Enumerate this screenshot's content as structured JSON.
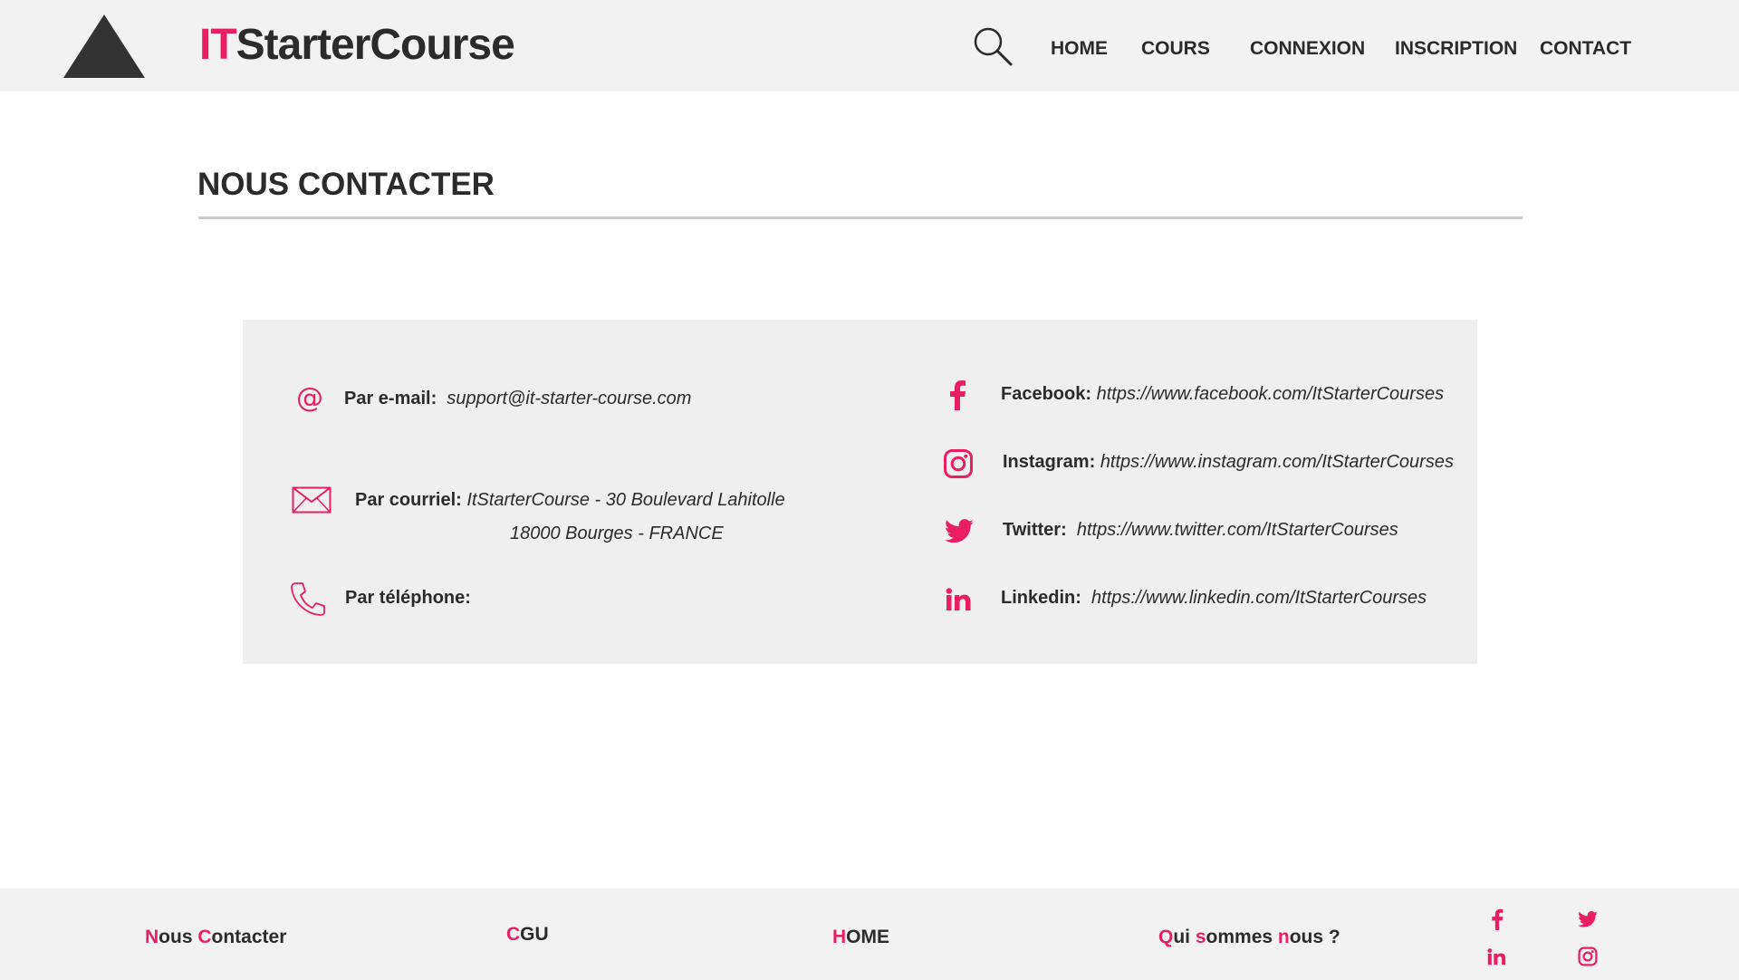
{
  "header": {
    "brand_prefix": "IT",
    "brand_suffix": "StarterCourse",
    "nav": {
      "home": "HOME",
      "cours": "COURS",
      "connexion": "CONNEXION",
      "inscription": "INSCRIPTION",
      "contact": "CONTACT"
    }
  },
  "page": {
    "title": "NOUS CONTACTER"
  },
  "contact": {
    "email": {
      "label": "Par e-mail:",
      "value": "support@it-starter-course.com",
      "icon": "at-icon"
    },
    "mail": {
      "label": "Par courriel:",
      "line1": "ItStarterCourse - 30 Boulevard Lahitolle",
      "line2": "18000 Bourges - FRANCE",
      "icon": "envelope-icon"
    },
    "phone": {
      "label": "Par téléphone:",
      "value": "",
      "icon": "phone-icon"
    },
    "facebook": {
      "label": "Facebook:",
      "value": "https://www.facebook.com/ItStarterCourses",
      "icon": "facebook-icon"
    },
    "instagram": {
      "label": "Instagram:",
      "value": "https://www.instagram.com/ItStarterCourses",
      "icon": "instagram-icon"
    },
    "twitter": {
      "label": "Twitter:",
      "value": "https://www.twitter.com/ItStarterCourses",
      "icon": "twitter-icon"
    },
    "linkedin": {
      "label": "Linkedin:",
      "value": "https://www.linkedin.com/ItStarterCourses",
      "icon": "linkedin-icon"
    }
  },
  "footer": {
    "nous_contacter": {
      "a1": "N",
      "b1": "ous ",
      "a2": "C",
      "b2": "ontacter"
    },
    "cgu": {
      "a": "C",
      "b": "GU"
    },
    "home": {
      "a": "H",
      "b": "OME"
    },
    "qui": {
      "a1": "Q",
      "b1": "ui ",
      "a2": "s",
      "b2": "ommes ",
      "a3": "n",
      "b3": "ous ?"
    }
  },
  "colors": {
    "accent": "#e91e63",
    "text": "#2b2b2b",
    "header_bg": "#f2f2f2",
    "box_bg": "#efefef"
  }
}
